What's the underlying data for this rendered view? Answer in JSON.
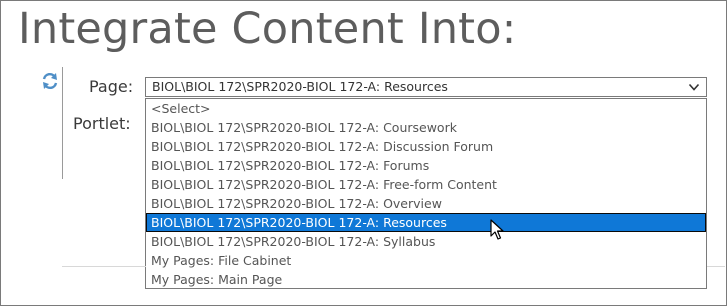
{
  "header": {
    "title": "Integrate Content Into:"
  },
  "form": {
    "page_label": "Page:",
    "portlet_label": "Portlet:",
    "page_select": {
      "selected": "BIOL\\BIOL 172\\SPR2020-BIOL 172-A: Resources",
      "options": [
        "<Select>",
        "BIOL\\BIOL 172\\SPR2020-BIOL 172-A: Coursework",
        "BIOL\\BIOL 172\\SPR2020-BIOL 172-A: Discussion Forum",
        "BIOL\\BIOL 172\\SPR2020-BIOL 172-A: Forums",
        "BIOL\\BIOL 172\\SPR2020-BIOL 172-A: Free-form Content",
        "BIOL\\BIOL 172\\SPR2020-BIOL 172-A: Overview",
        "BIOL\\BIOL 172\\SPR2020-BIOL 172-A: Resources",
        "BIOL\\BIOL 172\\SPR2020-BIOL 172-A: Syllabus",
        "My Pages: File Cabinet",
        "My Pages: Main Page"
      ],
      "highlighted_index": 6
    }
  },
  "icons": {
    "refresh": "refresh-icon",
    "chevron": "chevron-down-icon",
    "cursor": "mouse-pointer-icon"
  },
  "colors": {
    "highlight": "#0f78d7",
    "title": "#5d5d5d",
    "refresh": "#4f8fc7"
  }
}
